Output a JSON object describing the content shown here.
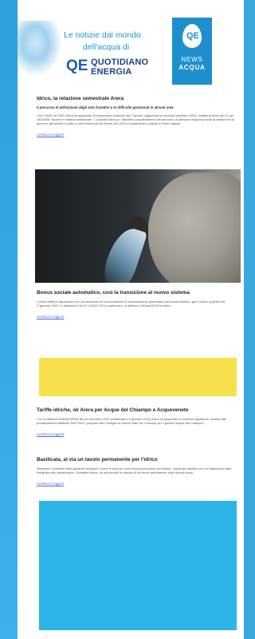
{
  "header": {
    "headline_line1": "Le notizie dal mondo",
    "headline_line2": "dell'acqua di",
    "brand_mark": "QE",
    "brand_line1": "QUOTIDIANO",
    "brand_line2": "ENERGIA",
    "badge_line1": "NEWS",
    "badge_line2": "ACQUA"
  },
  "articles": [
    {
      "title": "Idrico, la relazione semestrale Arera",
      "subtitle": "Il percorso di definizione degli enti d'ambito e le difficoltà gestionali in alcune aree",
      "body": "Con il finire del 2020 Arera ha approvato la sedicesima relazione alle Camere, aggiornata al secondo semestre 2020, redatta ai sensi del D.Lgs. 152/2006 \"Norme in materia ambientale\". L'Autorità rileva un \"definitivo completamento del percorso di adesione degli enti locali ai relativi enti di governo dell'ambito in tutte le aree territoriali del Paese (nel 2015 si registravano criticità in molte regioni).",
      "link": "continua a leggere"
    },
    {
      "title": "Bonus sociale automatico, così la transizione al nuovo sistema",
      "body": "L'Arera detta le disposizioni per la transizione al nuovo sistema di riconoscimento automatico del bonus elettrico, gas e idrico a partire dal 1°gennaio 2021, in attuazione del DL 124/19. Più in particolare, la delibera 11/Dacu/2020 fornisce...",
      "link": "continua a leggere"
    },
    {
      "title": "Tariffe idriche, ok Arera per Acque del Chiampo e Acquevenete",
      "body": "Con la delibera 608/2020/R/idr del 29 dicembre 2020 (pubblicata il 4 gennaio 2021) Arera ha approvato lo schema regolatorio, relativo alle predisposizioni tariffarie 2020-2023, proposto dal Consiglio di bacino Valle del Chiampo per il gestore Acque del Chiampo...",
      "link": "continua a leggere"
    },
    {
      "title": "Basilicata, al via un tavolo permanente per l'idrico",
      "body": "Affrontare i problemi della gestione ordinaria e porre le basi per una nuova governance del settore. Questi gli obiettivi con cui l'assessore della Basilicata alle infrastrutture, Donatella Merra, ha annunciato la nascita di un tavolo permanente sulla risorsa idrica...",
      "link": "continua a leggere"
    }
  ],
  "colors": {
    "page_background": "#3aa7df",
    "yellow_placeholder": "#f8e04c",
    "blue_placeholder": "#2db5ea",
    "brand_blue": "#1e8fcd"
  }
}
